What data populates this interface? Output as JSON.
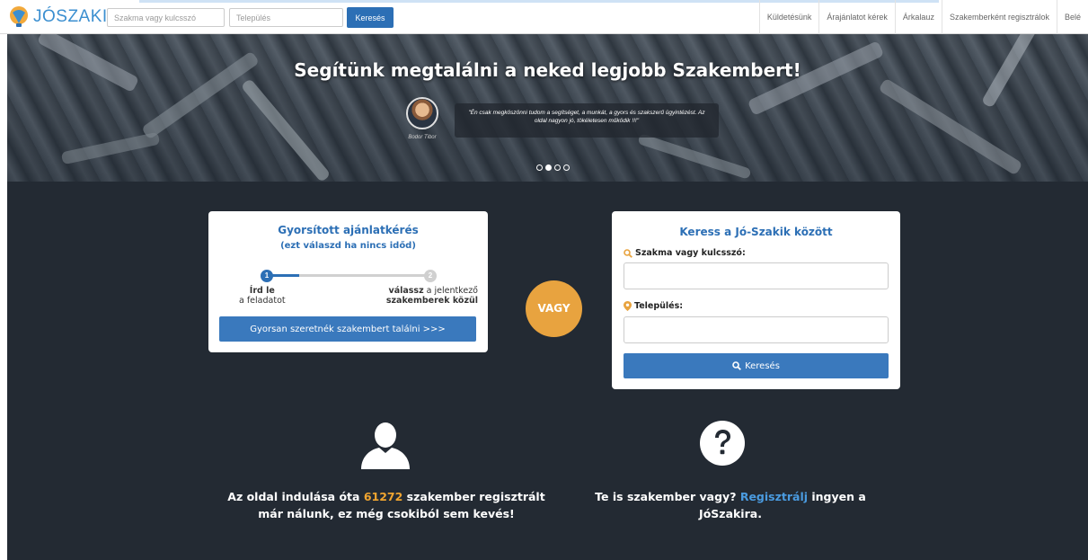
{
  "header": {
    "logo_text": "JÓSZAKI",
    "search_placeholder": "Szakma vagy kulcsszó",
    "location_placeholder": "Település",
    "search_button": "Keresés",
    "nav": [
      "Küldetésünk",
      "Árajánlatot kérek",
      "Árkalauz",
      "Szakemberként regisztrálok",
      "Belé"
    ]
  },
  "hero": {
    "title": "Segítünk megtalálni a neked legjobb Szakembert!",
    "testimonial": {
      "quote": "\"Én csak megköszönni tudom a segítséget, a munkát, a gyors és szakszerű ügyintézést. Az oldal nagyon jó, tökéletesen működik !!!\"",
      "author": "Bodor Tibor"
    },
    "carousel": {
      "count": 4,
      "active": 1
    }
  },
  "quick_request": {
    "title": "Gyorsított ajánlatkérés",
    "subtitle": "(ezt válaszd ha nincs időd)",
    "progress": 0.2,
    "step1": {
      "number": "1",
      "bold": "Írd le",
      "text": "a feladatot"
    },
    "step2": {
      "number": "2",
      "bold_a": "válassz",
      "text_a": " a jelentkező",
      "bold_b": "szakemberek közül"
    },
    "button": "Gyorsan szeretnék szakembert találni >>>"
  },
  "separator": "VAGY",
  "search_box": {
    "title": "Keress a Jó-Szakik között",
    "keyword_label": "Szakma vagy kulcsszó:",
    "location_label": "Település:",
    "button": "Keresés",
    "icon_color": "#e8a33f"
  },
  "features": {
    "left": {
      "text_a": "Az oldal indulása óta ",
      "count": "61272",
      "text_b": " szakember regisztrált",
      "text_c": "már nálunk, ez még csokiból sem kevés!"
    },
    "right": {
      "text_a": "Te is szakember vagy? ",
      "link": "Regisztrálj",
      "text_b": " ingyen a",
      "text_c": "JóSzakira."
    }
  },
  "colors": {
    "primary": "#2c6fb5",
    "accent": "#e8a33f",
    "dark_bg": "#232a33"
  }
}
